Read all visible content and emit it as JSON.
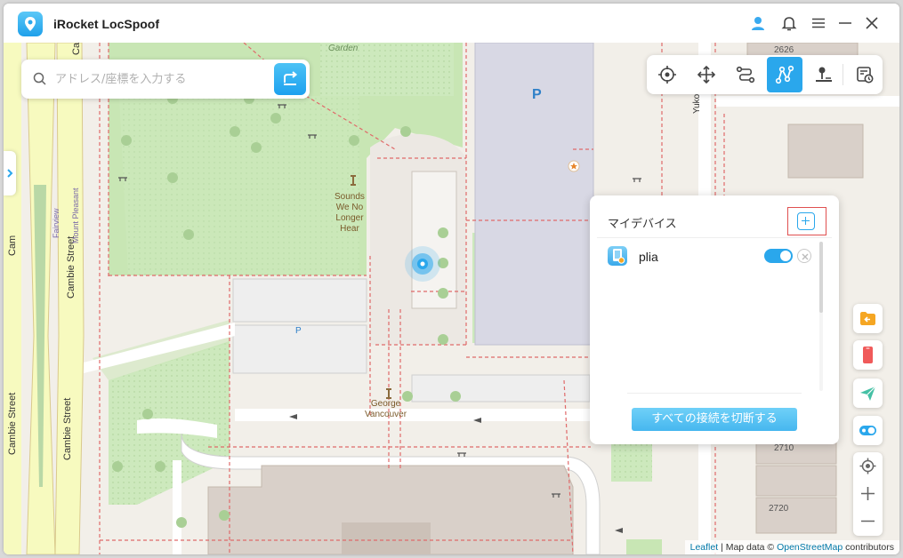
{
  "app": {
    "title": "iRocket LocSpoof"
  },
  "titlebar": {
    "icons": [
      "user-icon",
      "bell-icon",
      "menu-icon",
      "minimize-icon",
      "close-icon"
    ]
  },
  "search": {
    "placeholder": "アドレス/座標を入力する",
    "value": ""
  },
  "toolbar": {
    "tools": [
      {
        "name": "teleport-mode",
        "icon": "crosshair-icon"
      },
      {
        "name": "joystick-mode",
        "icon": "move-arrows-icon"
      },
      {
        "name": "two-spot-mode",
        "icon": "route-icon"
      },
      {
        "name": "multi-spot-mode",
        "icon": "multi-point-route-icon",
        "active": true
      },
      {
        "name": "jump-teleport-mode",
        "icon": "pin-stand-icon"
      },
      {
        "name": "history",
        "icon": "history-icon"
      }
    ]
  },
  "map": {
    "labels": {
      "garden": "Garden",
      "statue": "Sounds\nWe No\nLonger\nHear",
      "george": "George\nVancouver",
      "yukon": "Yukon St",
      "cambie1": "Cambie Street",
      "cambie2": "Cambie Street",
      "cambie3": "Cambie Street",
      "cambie_top": "Cambi",
      "mount_pleasant": "Mount Pleasant",
      "fairview": "Fairview",
      "cam": "Cam",
      "parking1": "P",
      "parking2": "P",
      "addr2626": "2626",
      "addr2710": "2710",
      "addr2720": "2720"
    }
  },
  "devices_panel": {
    "title": "マイデバイス",
    "devices": [
      {
        "name": "plia",
        "connected": true
      }
    ],
    "disconnect_all_label": "すべての接続を切断する"
  },
  "side_tools": [
    "import-gpx-icon",
    "phone-icon",
    "send-location-icon",
    "toggle-mode-icon"
  ],
  "zoom": [
    "locate-icon",
    "zoom-in-icon",
    "zoom-out-icon"
  ],
  "attribution": {
    "leaflet": "Leaflet",
    "sep": " | Map data © ",
    "osm": "OpenStreetMap",
    "suffix": " contributors"
  },
  "colors": {
    "accent": "#2aa7ec",
    "highlight_border": "#e05050",
    "road_yellow": "#f7fabf",
    "park_green": "#c8e6b4",
    "building": "#d9d0c9",
    "parking_lot": "#eeeeee"
  }
}
